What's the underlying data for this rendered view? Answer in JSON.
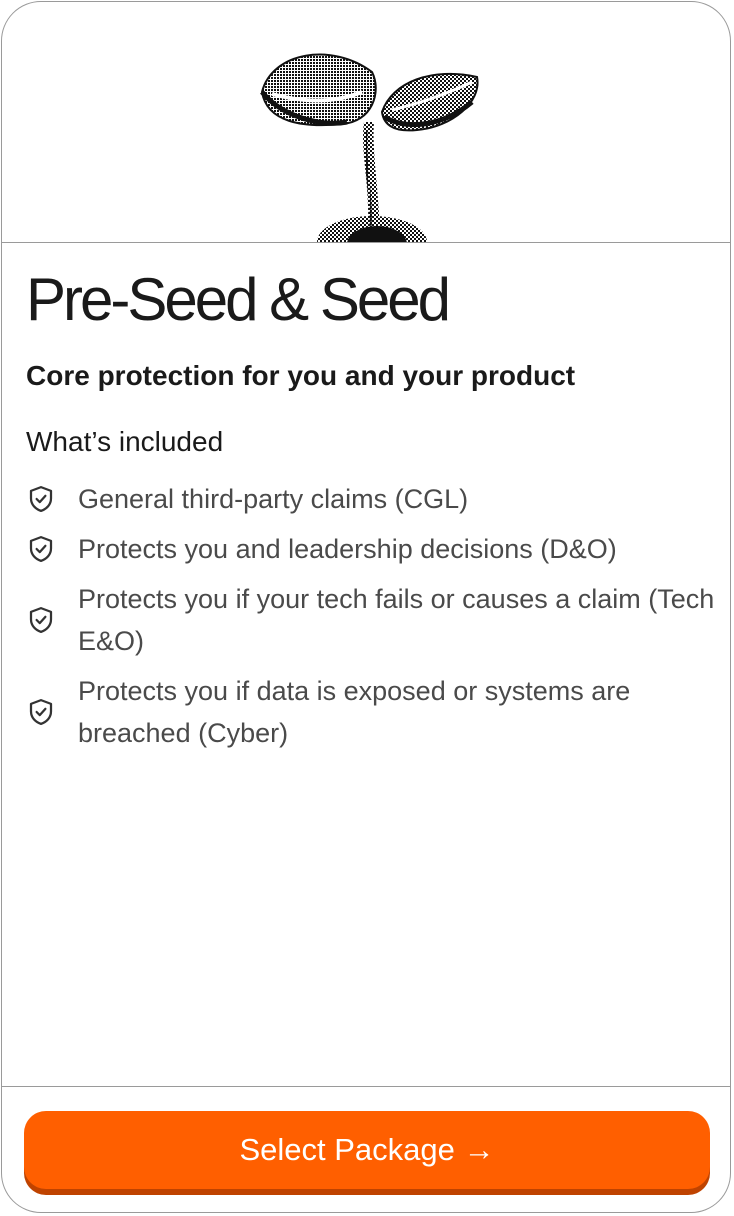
{
  "card": {
    "title": "Pre-Seed & Seed",
    "subtitle": "Core protection for you and your product",
    "included_heading": "What’s included",
    "features": [
      {
        "icon": "shield-check-icon",
        "text": "General third-party claims (CGL)"
      },
      {
        "icon": "shield-check-icon",
        "text": "Protects you and leadership decisions (D&O)"
      },
      {
        "icon": "shield-check-icon",
        "text": "Protects you if your tech fails or causes a claim (Tech E&O)"
      },
      {
        "icon": "shield-check-icon",
        "text": "Protects you if data is exposed or systems are breached (Cyber)"
      }
    ],
    "hero_icon": "seedling-illustration",
    "button_label": "Select Package →"
  },
  "colors": {
    "accent": "#ff5f00",
    "accent_shadow": "#bf4300",
    "border": "#9a9a9a",
    "text_primary": "#1a1a1a",
    "text_secondary": "#4a4a4a"
  }
}
